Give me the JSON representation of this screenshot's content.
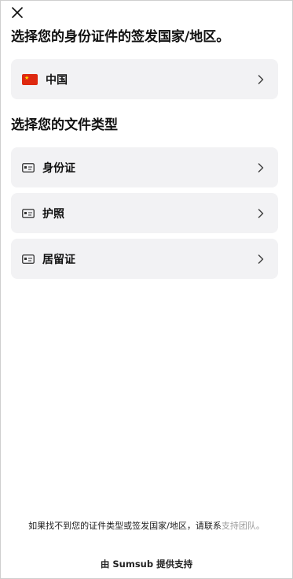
{
  "header": {
    "close_icon": "close-icon"
  },
  "country_section": {
    "title": "选择您的身份证件的签发国家/地区。",
    "selected": {
      "flag": "china-flag-icon",
      "label": "中国",
      "chevron": "chevron-right-icon"
    }
  },
  "document_section": {
    "title": "选择您的文件类型",
    "items": [
      {
        "icon": "id-card-icon",
        "label": "身份证"
      },
      {
        "icon": "id-card-icon",
        "label": "护照"
      },
      {
        "icon": "id-card-icon",
        "label": "居留证"
      }
    ]
  },
  "footer": {
    "help_text": "如果找不到您的证件类型或签发国家/地区，请联系",
    "support_link": "支持团队。",
    "powered_by": "由 Sumsub 提供支持"
  },
  "colors": {
    "card_bg": "#f2f2f4",
    "link": "#9a9a9a",
    "flag_red": "#de2910"
  }
}
